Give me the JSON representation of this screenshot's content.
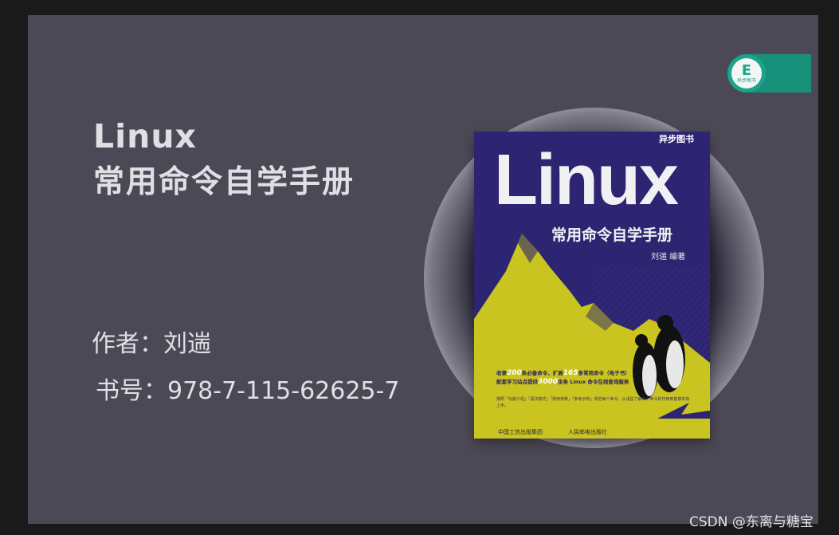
{
  "slide": {
    "title_line1": "Linux",
    "title_line2": "常用命令自学手册",
    "author": "作者：刘遄",
    "isbn": "书号：978-7-115-62625-7"
  },
  "book_cover": {
    "title": "Linux",
    "subtitle": "常用命令自学手册",
    "author": "刘遄  编著",
    "publisher_badge": "异步图书",
    "blurb_line1_a": "收录",
    "blurb_line1_num1": "200",
    "blurb_line1_b": "条必备命令，扩展",
    "blurb_line1_num2": "165",
    "blurb_line1_c": "条常用命令（电子书）",
    "blurb_line2_a": "配套学习站点提供",
    "blurb_line2_num": "3000",
    "blurb_line2_b": "余条 Linux 命令在线查询服务",
    "tags": "按照「功能介绍」「语法格式」「常用参数」「参考示例」规范每个命令，从浅显了解每个命令的作用到能够实际上手。",
    "publisher_left": "中国工信出版集团",
    "publisher_right": "人民邮电出版社"
  },
  "brand_logo": {
    "glyph": "E",
    "text": "异步图书"
  },
  "watermark": "CSDN @东离与糖宝",
  "colors": {
    "slide_bg": "#4c4956",
    "cover_bg": "#2e2572",
    "cover_yellow": "#c9c420",
    "brand_green": "#17917a"
  }
}
